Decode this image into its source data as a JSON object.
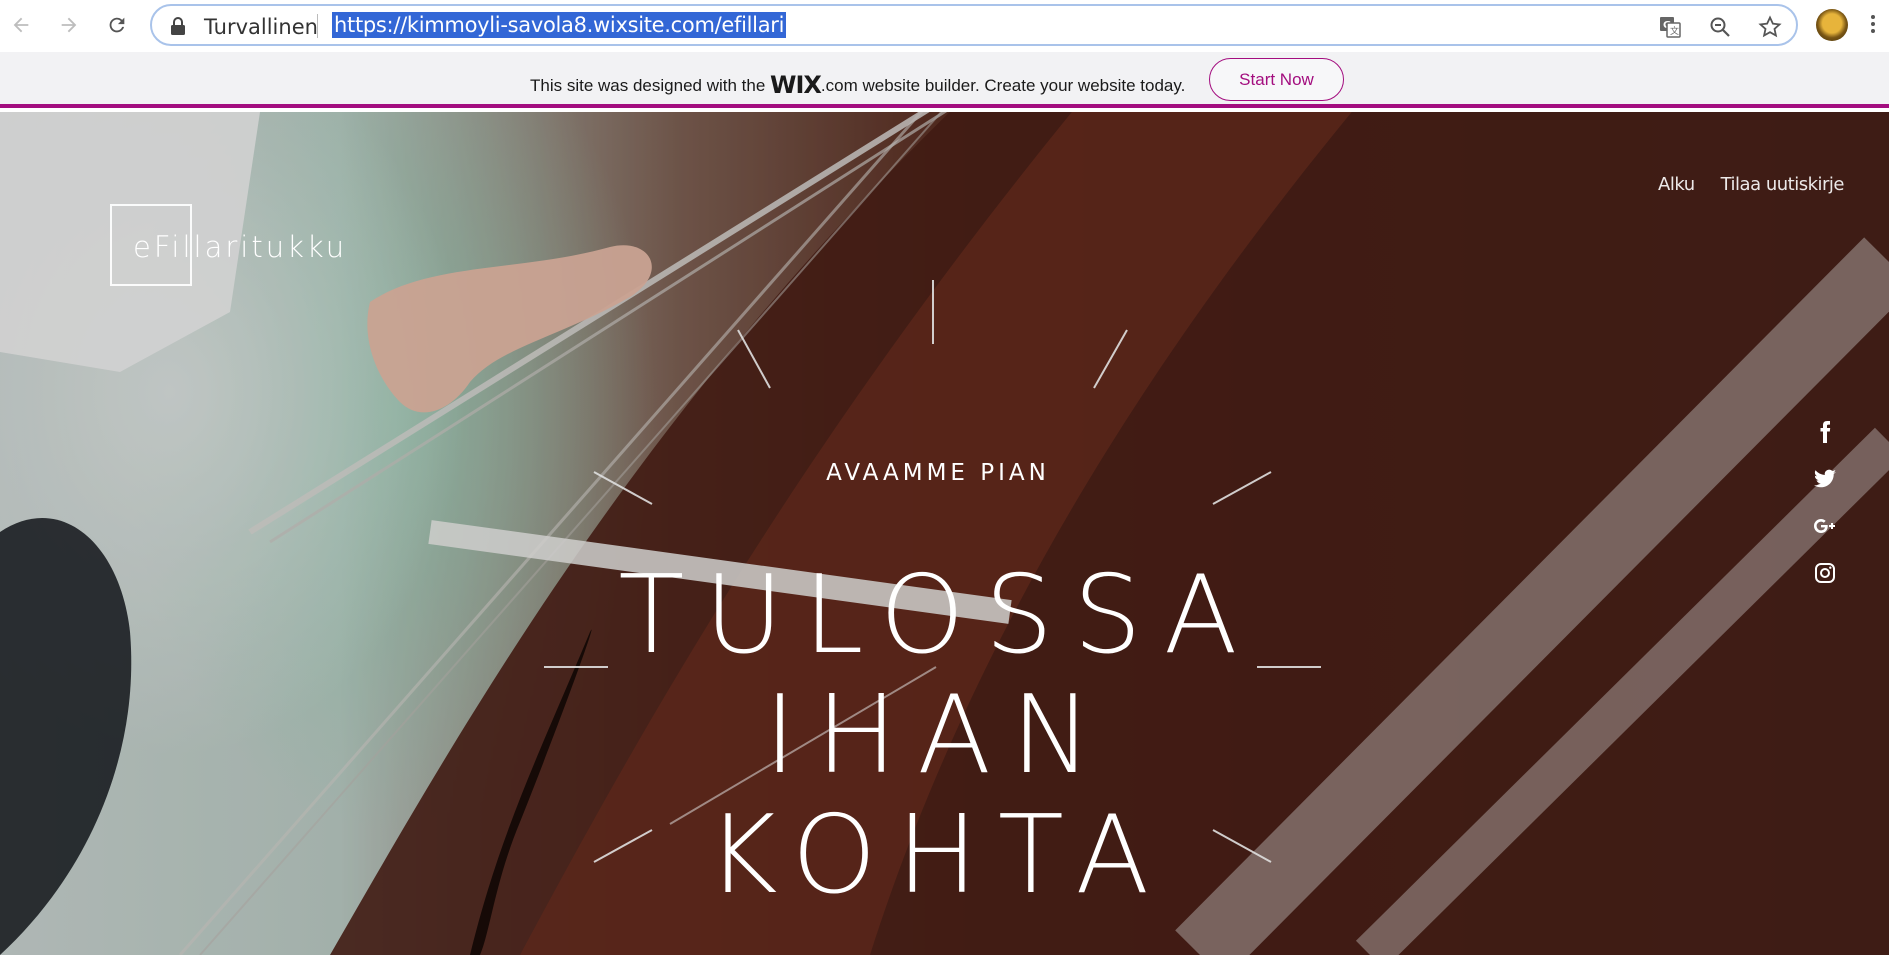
{
  "browser": {
    "security_label": "Turvallinen",
    "url": "https://kimmoyli-savola8.wixsite.com/efillari"
  },
  "wix_banner": {
    "text_before": "This site was designed with the ",
    "logo_wix": "WIX",
    "logo_com": ".com",
    "text_after": " website builder. Create your website today.",
    "button": "Start Now",
    "accent_color": "#a30d7f"
  },
  "site": {
    "logo": "eFillaritukku",
    "nav": [
      "Alku",
      "Tilaa uutiskirje"
    ],
    "social": [
      "facebook-icon",
      "twitter-icon",
      "google-plus-icon",
      "instagram-icon"
    ]
  },
  "hero": {
    "subtitle": "AVAAMME PIAN",
    "line1": "TULOSSA",
    "line2": "IHAN",
    "line3": "KOHTA"
  }
}
